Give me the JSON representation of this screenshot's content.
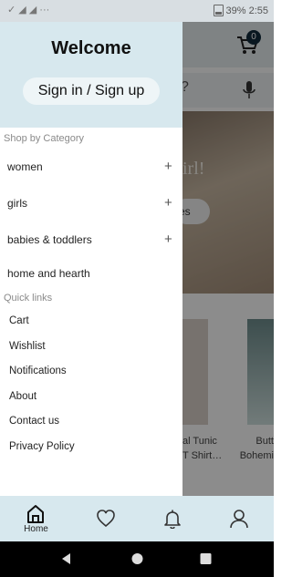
{
  "status_bar": {
    "notification_icons": "✓ ◢ ◢ ···",
    "battery": "39%",
    "time": "2:55"
  },
  "background": {
    "cart_count": "0",
    "search_fragment": "?",
    "hero_text": "irl!",
    "hero_button_fragment": "es",
    "product_captions": [
      "al Tunic\nT Shirt…",
      "Butt\nBohemi"
    ]
  },
  "drawer": {
    "title": "Welcome",
    "sign_in_label": "Sign in / Sign up",
    "shop_section_label": "Shop by Category",
    "categories": [
      {
        "label": "women",
        "expandable": true
      },
      {
        "label": "girls",
        "expandable": true
      },
      {
        "label": "babies & toddlers",
        "expandable": true
      },
      {
        "label": "home and hearth",
        "expandable": false
      }
    ],
    "quick_links_label": "Quick links",
    "quick_links": [
      "Cart",
      "Wishlist",
      "Notifications",
      "About",
      "Contact us",
      "Privacy Policy"
    ]
  },
  "bottom_nav": {
    "home_label": "Home"
  },
  "colors": {
    "drawer_header": "#d7e8ee",
    "accent": "#112a3b"
  }
}
